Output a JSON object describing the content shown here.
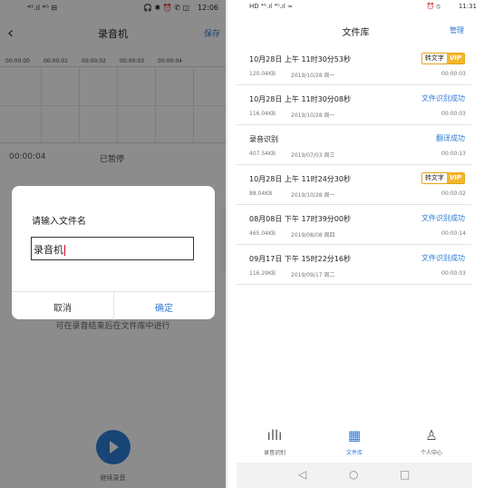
{
  "left": {
    "status": {
      "signal": "⁴ᴳ.ıl ⁴ᴳ ⊟",
      "icons": "🎧 ✱ ⏰ ✆ ◫",
      "time": "12:06"
    },
    "header": {
      "back_icon": "chevron-left-icon",
      "title": "录音机",
      "save": "保存"
    },
    "timeline": [
      "00:00:00",
      "00:00:01",
      "00:00:02",
      "00:00:03",
      "00:00:04"
    ],
    "elapsed": "00:00:04",
    "state": "已暂停",
    "hint": "可在录音结束后在文件库中进行",
    "continue_label": "继续录音",
    "dialog": {
      "title": "请输入文件名",
      "input_value": "录音机",
      "cancel": "取消",
      "ok": "确定"
    }
  },
  "right": {
    "status": {
      "signal": "HD ⁴ᴳ.ıl ⁴ᴳ.ıl ≈",
      "icons": "⏰ ⦸",
      "time": "11:31"
    },
    "header": {
      "title": "文件库",
      "manage": "管理"
    },
    "files": [
      {
        "name": "10月28日 上午 11时30分53秒",
        "size": "120.04KB",
        "date": "2019/10/28 周一",
        "duration": "00:00:03",
        "status": "",
        "vip_label": "转文字",
        "vip_tag": "VIP"
      },
      {
        "name": "10月28日 上午 11时30分08秒",
        "size": "116.04KB",
        "date": "2019/10/28 周一",
        "duration": "00:00:03",
        "status": "文件识别成功"
      },
      {
        "name": "录音识别",
        "size": "407.54KB",
        "date": "2019/07/03 周三",
        "duration": "00:00:13",
        "status": "翻译成功"
      },
      {
        "name": "10月28日 上午 11时24分30秒",
        "size": "88.04KB",
        "date": "2019/10/28 周一",
        "duration": "00:00:02",
        "status": "",
        "vip_label": "转文字",
        "vip_tag": "VIP"
      },
      {
        "name": "08月08日 下午 17时39分00秒",
        "size": "465.04KB",
        "date": "2019/08/08 周四",
        "duration": "00:00:14",
        "status": "文件识别成功"
      },
      {
        "name": "09月17日 下午 15时22分16秒",
        "size": "116.29KB",
        "date": "2019/09/17 周二",
        "duration": "00:00:03",
        "status": "文件识别成功"
      }
    ],
    "tabs": [
      {
        "label": "录音识别",
        "icon": "waveform-icon",
        "glyph": "ıllı"
      },
      {
        "label": "文件库",
        "icon": "qr-library-icon",
        "glyph": "▦",
        "active": true
      },
      {
        "label": "个人中心",
        "icon": "person-icon",
        "glyph": "♙"
      }
    ],
    "sysnav": {
      "back": "◁",
      "home": "○",
      "recent": "□"
    }
  },
  "colors": {
    "accent": "#2e7bd6",
    "vip": "#f5b62b"
  }
}
